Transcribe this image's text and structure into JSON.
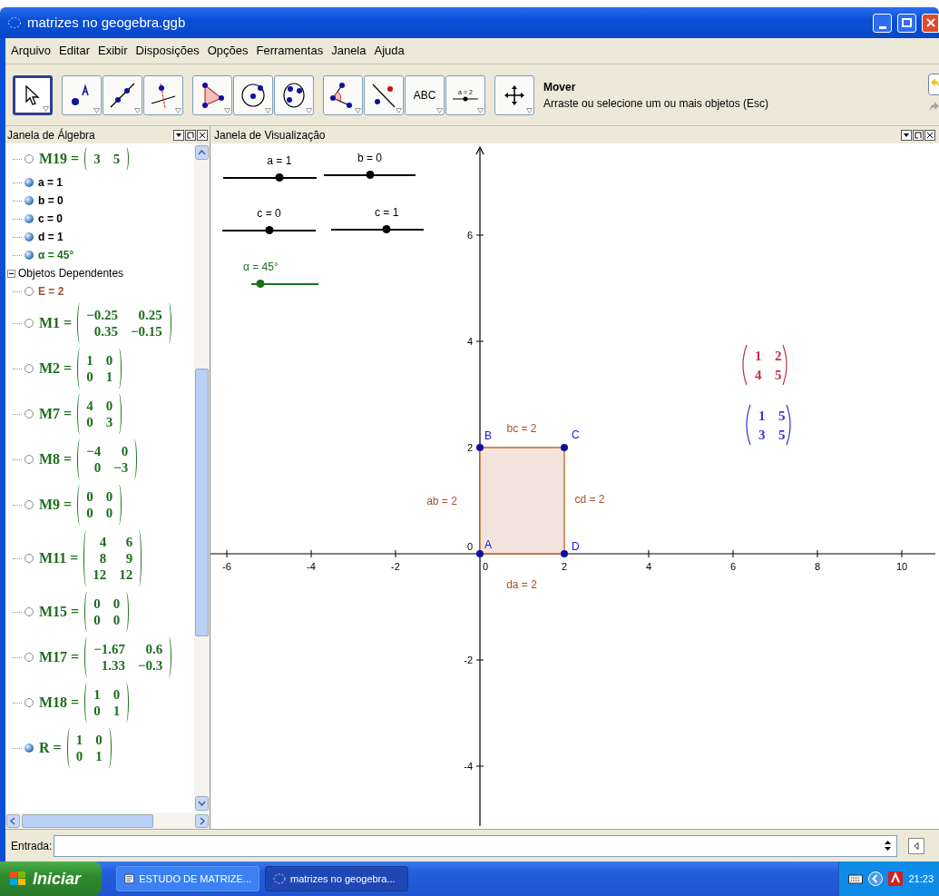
{
  "window": {
    "title": "matrizes no geogebra.ggb"
  },
  "menu": [
    "Arquivo",
    "Editar",
    "Exibir",
    "Disposições",
    "Opções",
    "Ferramentas",
    "Janela",
    "Ajuda"
  ],
  "toolbar": {
    "tools": [
      {
        "kind": "move",
        "selected": true
      },
      {
        "kind": "point",
        "selected": false
      },
      {
        "kind": "line",
        "selected": false
      },
      {
        "kind": "perpendicular",
        "selected": false
      },
      {
        "kind": "polygon",
        "selected": false
      },
      {
        "kind": "circle",
        "selected": false
      },
      {
        "kind": "conic",
        "selected": false
      },
      {
        "kind": "angle",
        "selected": false
      },
      {
        "kind": "reflect",
        "selected": false
      },
      {
        "kind": "text",
        "label": "ABC",
        "selected": false
      },
      {
        "kind": "slider",
        "label": "a = 2",
        "selected": false
      },
      {
        "kind": "move_view",
        "selected": false
      }
    ],
    "help": {
      "title": "Mover",
      "description": "Arraste ou selecione um ou mais objetos (Esc)"
    }
  },
  "algebra": {
    "title": "Janela de Álgebra",
    "free_objects": [
      {
        "kind": "matrix",
        "name": "M19 =",
        "rows": [
          [
            "3",
            "5"
          ]
        ],
        "visible": false,
        "color": "#1e6e1e"
      },
      {
        "kind": "value",
        "text": "a = 1",
        "visible": true,
        "color": "#000000"
      },
      {
        "kind": "value",
        "text": "b = 0",
        "visible": true,
        "color": "#000000"
      },
      {
        "kind": "value",
        "text": "c = 0",
        "visible": true,
        "color": "#000000"
      },
      {
        "kind": "value",
        "text": "d = 1",
        "visible": true,
        "color": "#000000"
      },
      {
        "kind": "value",
        "text": "α = 45°",
        "visible": true,
        "color": "#1e6e1e"
      }
    ],
    "dependent_group": {
      "label": "Objetos Dependentes",
      "expanded": true,
      "children": [
        {
          "kind": "value",
          "text": "E = 2",
          "visible": false,
          "color": "#a0522d"
        },
        {
          "kind": "matrix",
          "name": "M1 =",
          "rows": [
            [
              "−0.25",
              "0.25"
            ],
            [
              "0.35",
              "−0.15"
            ]
          ],
          "visible": false,
          "color": "#1e6e1e"
        },
        {
          "kind": "matrix",
          "name": "M2 =",
          "rows": [
            [
              "1",
              "0"
            ],
            [
              "0",
              "1"
            ]
          ],
          "visible": false,
          "color": "#1e6e1e"
        },
        {
          "kind": "matrix",
          "name": "M7 =",
          "rows": [
            [
              "4",
              "0"
            ],
            [
              "0",
              "3"
            ]
          ],
          "visible": false,
          "color": "#1e6e1e"
        },
        {
          "kind": "matrix",
          "name": "M8 =",
          "rows": [
            [
              "−4",
              "0"
            ],
            [
              "0",
              "−3"
            ]
          ],
          "visible": false,
          "color": "#1e6e1e"
        },
        {
          "kind": "matrix",
          "name": "M9 =",
          "rows": [
            [
              "0",
              "0"
            ],
            [
              "0",
              "0"
            ]
          ],
          "visible": false,
          "color": "#1e6e1e"
        },
        {
          "kind": "matrix",
          "name": "M11 =",
          "rows": [
            [
              "4",
              "6"
            ],
            [
              "8",
              "9"
            ],
            [
              "12",
              "12"
            ]
          ],
          "visible": false,
          "color": "#1e6e1e"
        },
        {
          "kind": "matrix",
          "name": "M15 =",
          "rows": [
            [
              "0",
              "0"
            ],
            [
              "0",
              "0"
            ]
          ],
          "visible": false,
          "color": "#1e6e1e"
        },
        {
          "kind": "matrix",
          "name": "M17 =",
          "rows": [
            [
              "−1.67",
              "0.6"
            ],
            [
              "1.33",
              "−0.3"
            ]
          ],
          "visible": false,
          "color": "#1e6e1e"
        },
        {
          "kind": "matrix",
          "name": "M18 =",
          "rows": [
            [
              "1",
              "0"
            ],
            [
              "0",
              "1"
            ]
          ],
          "visible": false,
          "color": "#1e6e1e"
        },
        {
          "kind": "matrix",
          "name": "R =",
          "rows": [
            [
              "1",
              "0"
            ],
            [
              "0",
              "1"
            ]
          ],
          "visible": true,
          "color": "#1e6e1e"
        }
      ]
    }
  },
  "graphics": {
    "title": "Janela de Visualização",
    "sliders": [
      {
        "label": "a = 1",
        "level": 0.6,
        "color": "#000000"
      },
      {
        "label": "b = 0",
        "level": 0.5,
        "color": "#000000"
      },
      {
        "label": "c = 0",
        "level": 0.5,
        "color": "#000000"
      },
      {
        "label": "c = 1",
        "level": 0.6,
        "color": "#000000"
      },
      {
        "label": "α = 45°",
        "level": 0.14,
        "color": "#1e6e1e"
      }
    ],
    "x_ticks": [
      "-6",
      "-4",
      "-2",
      "0",
      "2",
      "4",
      "6",
      "8",
      "10"
    ],
    "y_ticks": [
      "6",
      "4",
      "2",
      "0",
      "-2",
      "-4"
    ],
    "points": [
      "B",
      "C",
      "A",
      "D"
    ],
    "segments": [
      "ab = 2",
      "bc = 2",
      "cd = 2",
      "da = 2"
    ],
    "matrices": [
      {
        "rows": [
          [
            "1",
            "2"
          ],
          [
            "4",
            "5"
          ]
        ],
        "color": "#c0304a"
      },
      {
        "rows": [
          [
            "1",
            "5"
          ],
          [
            "3",
            "5"
          ]
        ],
        "color": "#3434d0"
      }
    ]
  },
  "input_bar": {
    "label": "Entrada:"
  },
  "taskbar": {
    "start": "Iniciar",
    "tasks": [
      {
        "label": "ESTUDO DE MATRIZE...",
        "selected": false
      },
      {
        "label": "matrizes no geogebra...",
        "selected": true
      }
    ],
    "clock": "21:23"
  }
}
